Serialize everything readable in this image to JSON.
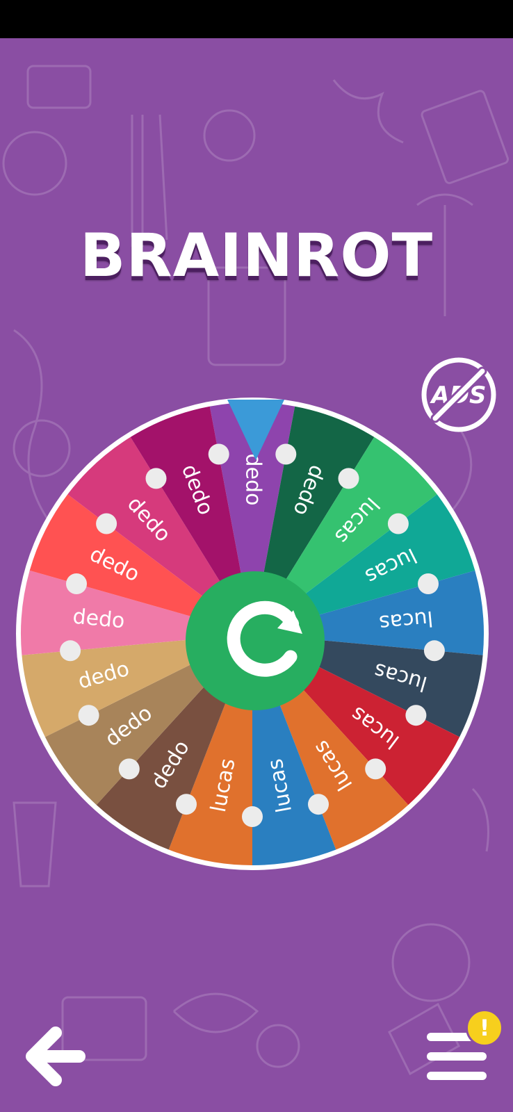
{
  "app": {
    "title": "BRAINROT"
  },
  "wheel": {
    "segments": [
      {
        "label": "dedo",
        "color": "#8e44ad"
      },
      {
        "label": "dedo",
        "color": "#136646"
      },
      {
        "label": "lucas",
        "color": "#35c270"
      },
      {
        "label": "lucas",
        "color": "#10a896"
      },
      {
        "label": "lucas",
        "color": "#2a7fc0"
      },
      {
        "label": "lucas",
        "color": "#34495e"
      },
      {
        "label": "lucas",
        "color": "#cc2233"
      },
      {
        "label": "lucas",
        "color": "#e0712d"
      },
      {
        "label": "lucas",
        "color": "#2a7fc0"
      },
      {
        "label": "lucas",
        "color": "#e0712d"
      },
      {
        "label": "dedo",
        "color": "#795040"
      },
      {
        "label": "dedo",
        "color": "#a8845a"
      },
      {
        "label": "dedo",
        "color": "#d5a96a"
      },
      {
        "label": "dedo",
        "color": "#f07aa8"
      },
      {
        "label": "dedo",
        "color": "#ff5252"
      },
      {
        "label": "dedo",
        "color": "#d63a7c"
      },
      {
        "label": "dedo",
        "color": "#a3126a"
      }
    ],
    "pointer_color": "#3b9ad8",
    "hub_color": "#27ae60"
  },
  "ads_button": {
    "label": "ADS"
  },
  "icons": {
    "back": "arrow-left-icon",
    "spin": "refresh-icon",
    "menu": "hamburger-menu-icon",
    "alert": "exclamation-icon"
  },
  "menu": {
    "badge": "!"
  }
}
